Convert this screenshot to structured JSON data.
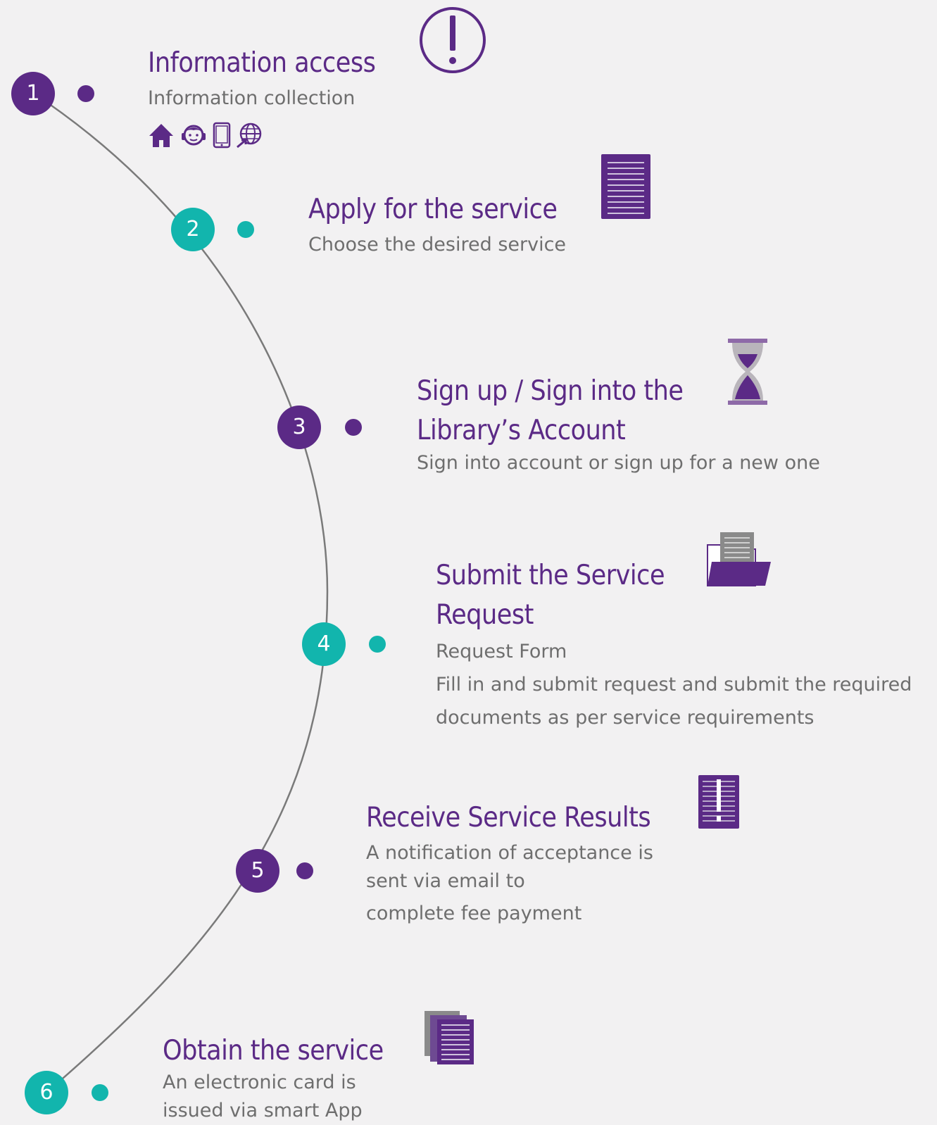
{
  "steps": [
    {
      "number": "1",
      "title": "Information access",
      "description": [
        "Information collection"
      ],
      "icon": "exclamation-circle-icon",
      "channels": [
        "home-icon",
        "customer-service-icon",
        "mobile-icon",
        "web-icon"
      ]
    },
    {
      "number": "2",
      "title": "Apply for the service",
      "description": [
        "Choose the desired service"
      ],
      "icon": "document-icon"
    },
    {
      "number": "3",
      "title_lines": [
        "Sign up / Sign into the",
        "Library’s Account"
      ],
      "description": [
        "Sign into account or sign up for a new one"
      ],
      "icon": "hourglass-icon"
    },
    {
      "number": "4",
      "title_lines": [
        "Submit the Service",
        "Request"
      ],
      "description": [
        "Request Form",
        "Fill in and submit request and submit the required",
        "documents as per service requirements"
      ],
      "icon": "folder-icon"
    },
    {
      "number": "5",
      "title": "Receive Service Results",
      "description": [
        "A notification of acceptance is",
        "sent via email to",
        "complete fee payment"
      ],
      "icon": "notice-document-icon"
    },
    {
      "number": "6",
      "title": "Obtain the service",
      "description": [
        "An electronic card is",
        "issued via smart App"
      ],
      "icon": "stacked-documents-icon"
    }
  ],
  "colors": {
    "purple": "#5b2a86",
    "teal": "#12b5ad",
    "gray_text": "#6e6e6e",
    "background": "#f2f1f2",
    "line": "#7a7a7a"
  }
}
